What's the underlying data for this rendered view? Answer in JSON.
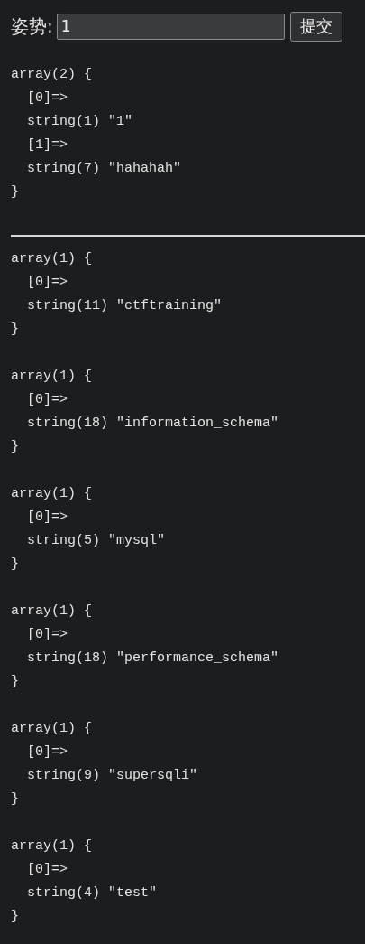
{
  "form": {
    "label": "姿势:",
    "value": "1",
    "button": "提交"
  },
  "first_dump": {
    "lines": [
      {
        "text": "array(2) {",
        "indented": false
      },
      {
        "text": "[0]=>",
        "indented": true
      },
      {
        "text": "string(1) \"1\"",
        "indented": true
      },
      {
        "text": "[1]=>",
        "indented": true
      },
      {
        "text": "string(7) \"hahahah\"",
        "indented": true
      },
      {
        "text": "}",
        "indented": false
      }
    ]
  },
  "results": [
    {
      "lines": [
        {
          "text": "array(1) {",
          "indented": false
        },
        {
          "text": "[0]=>",
          "indented": true
        },
        {
          "text": "string(11) \"ctftraining\"",
          "indented": true
        },
        {
          "text": "}",
          "indented": false
        }
      ]
    },
    {
      "lines": [
        {
          "text": "array(1) {",
          "indented": false
        },
        {
          "text": "[0]=>",
          "indented": true
        },
        {
          "text": "string(18) \"information_schema\"",
          "indented": true
        },
        {
          "text": "}",
          "indented": false
        }
      ]
    },
    {
      "lines": [
        {
          "text": "array(1) {",
          "indented": false
        },
        {
          "text": "[0]=>",
          "indented": true
        },
        {
          "text": "string(5) \"mysql\"",
          "indented": true
        },
        {
          "text": "}",
          "indented": false
        }
      ]
    },
    {
      "lines": [
        {
          "text": "array(1) {",
          "indented": false
        },
        {
          "text": "[0]=>",
          "indented": true
        },
        {
          "text": "string(18) \"performance_schema\"",
          "indented": true
        },
        {
          "text": "}",
          "indented": false
        }
      ]
    },
    {
      "lines": [
        {
          "text": "array(1) {",
          "indented": false
        },
        {
          "text": "[0]=>",
          "indented": true
        },
        {
          "text": "string(9) \"supersqli\"",
          "indented": true
        },
        {
          "text": "}",
          "indented": false
        }
      ]
    },
    {
      "lines": [
        {
          "text": "array(1) {",
          "indented": false
        },
        {
          "text": "[0]=>",
          "indented": true
        },
        {
          "text": "string(4) \"test\"",
          "indented": true
        },
        {
          "text": "}",
          "indented": false
        }
      ]
    }
  ]
}
